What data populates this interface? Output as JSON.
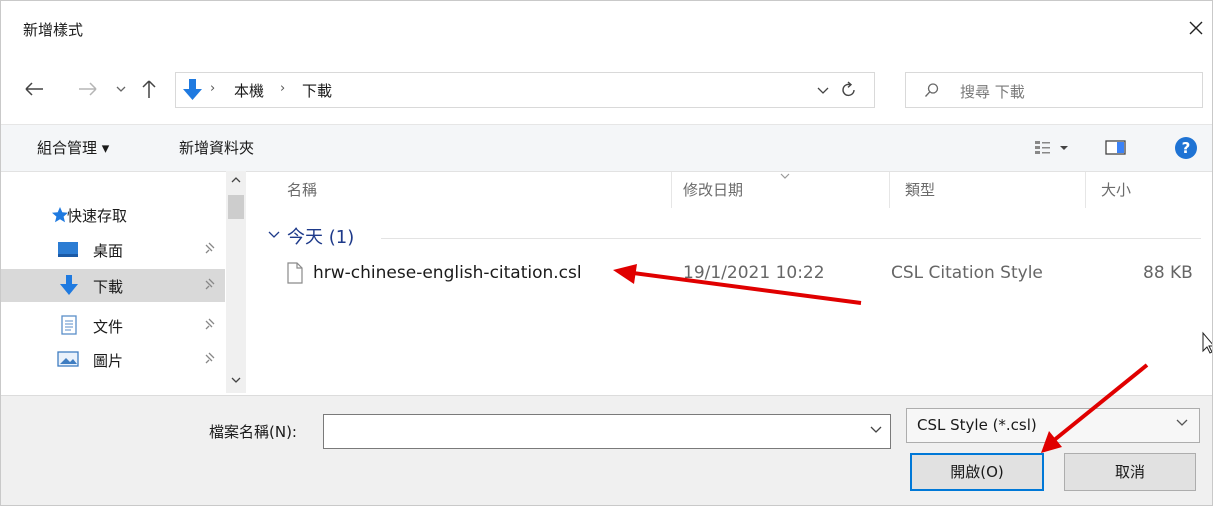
{
  "window": {
    "title": "新增樣式"
  },
  "address": {
    "crumbs": [
      "本機",
      "下載"
    ],
    "separator": "›"
  },
  "search": {
    "placeholder": "搜尋 下載"
  },
  "toolbar": {
    "organize_label": "組合管理 ▾",
    "new_folder_label": "新增資料夾"
  },
  "sidebar": {
    "quick_access": "快速存取",
    "items": [
      {
        "label": "桌面",
        "icon": "desktop-icon"
      },
      {
        "label": "下載",
        "icon": "download-arrow-icon",
        "selected": true
      },
      {
        "label": "文件",
        "icon": "document-icon"
      },
      {
        "label": "圖片",
        "icon": "pictures-icon"
      }
    ]
  },
  "columns": {
    "name": "名稱",
    "modified": "修改日期",
    "type": "類型",
    "size": "大小"
  },
  "group": {
    "label": "今天 (1)"
  },
  "files": [
    {
      "name": "hrw-chinese-english-citation.csl",
      "modified": "19/1/2021 10:22",
      "type": "CSL Citation Style",
      "size": "88 KB"
    }
  ],
  "bottom": {
    "filename_label": "檔案名稱(N):",
    "filename_value": "",
    "filetype_value": "CSL Style (*.csl)",
    "open_label": "開啟(O)",
    "cancel_label": "取消"
  },
  "colors": {
    "accent": "#0078d7",
    "annotation_arrow": "#e00000",
    "help": "#1e73d4",
    "selection": "#d9d9d9"
  }
}
